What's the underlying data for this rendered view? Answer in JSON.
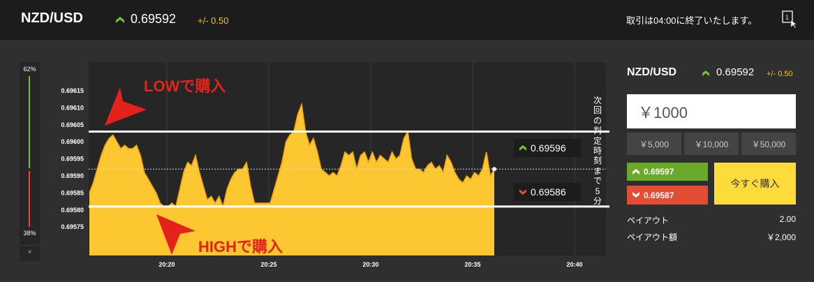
{
  "header": {
    "pair": "NZD/USD",
    "price": "0.69592",
    "change": "+/- 0.50",
    "notice": "取引は04:00に終了いたします。",
    "window_icon_label": "1"
  },
  "gauge": {
    "high_pct": "62%",
    "low_pct": "38%",
    "close_label": "×"
  },
  "chart_data": {
    "type": "area",
    "y_ticks": [
      "0.69615",
      "0.69610",
      "0.69605",
      "0.69600",
      "0.69595",
      "0.69590",
      "0.69585",
      "0.69580",
      "0.69575"
    ],
    "x_ticks": [
      "20:20",
      "20:25",
      "20:30",
      "20:35",
      "20:40"
    ],
    "ylim": [
      0.6957,
      0.6962
    ],
    "grid": true,
    "current_price": 0.69592,
    "upper_line": 0.69603,
    "lower_line": 0.69581,
    "series": [
      {
        "values": [
          0.69585,
          0.69588,
          0.69592,
          0.69596,
          0.69599,
          0.69601,
          0.69602,
          0.696,
          0.69598,
          0.69599,
          0.69598,
          0.69598,
          0.69599,
          0.69596,
          0.69591,
          0.69589,
          0.69587,
          0.69585,
          0.69582,
          0.69581,
          0.69581,
          0.69582,
          0.69581,
          0.69586,
          0.69591,
          0.69594,
          0.69593,
          0.69596,
          0.69591,
          0.69587,
          0.69583,
          0.69584,
          0.69582,
          0.69584,
          0.69581,
          0.69586,
          0.69589,
          0.69591,
          0.69592,
          0.69592,
          0.69594,
          0.69587,
          0.69582,
          0.69582,
          0.69582,
          0.69582,
          0.69582,
          0.69586,
          0.6959,
          0.69594,
          0.696,
          0.69602,
          0.69603,
          0.69608,
          0.69611,
          0.69603,
          0.69599,
          0.69601,
          0.69597,
          0.69592,
          0.69591,
          0.6959,
          0.69591,
          0.6959,
          0.69593,
          0.69597,
          0.69596,
          0.69597,
          0.69592,
          0.69596,
          0.69597,
          0.69594,
          0.69597,
          0.69594,
          0.69596,
          0.69595,
          0.69594,
          0.69597,
          0.69595,
          0.69596,
          0.69601,
          0.69603,
          0.69595,
          0.69592,
          0.69592,
          0.69591,
          0.69593,
          0.69594,
          0.69592,
          0.69593,
          0.69591,
          0.69596,
          0.69594,
          0.69591,
          0.69589,
          0.69588,
          0.6959,
          0.69589,
          0.69591,
          0.6959,
          0.69592,
          0.69597,
          0.6959,
          0.69592
        ]
      }
    ],
    "labels": {
      "upper": "0.69596",
      "lower": "0.69586"
    },
    "colors": {
      "area": "#fdc731",
      "line": "#f4a40a",
      "grid": "#3c3c3c",
      "plot_bg": "#262626"
    }
  },
  "annotations": {
    "low_buy": "LOWで購入",
    "high_buy": "HIGHで購入",
    "next_decision": "次回の判定時刻まで5分"
  },
  "panel": {
    "pair": "NZD/USD",
    "price": "0.69592",
    "change": "+/- 0.50",
    "amount": "￥1000",
    "presets": [
      "￥5,000",
      "￥10,000",
      "￥50,000"
    ],
    "high_button": "0.69597",
    "low_button": "0.69587",
    "buy_now": "今すぐ購入",
    "payout_label": "ペイアウト",
    "payout_value": "2.00",
    "payout_amount_label": "ペイアウト額",
    "payout_amount_value": "￥2,000"
  },
  "colors": {
    "up": "#7cbf2f",
    "down": "#e34d36",
    "accent_yellow": "#fddb3a",
    "annotation_red": "#e4221b"
  }
}
